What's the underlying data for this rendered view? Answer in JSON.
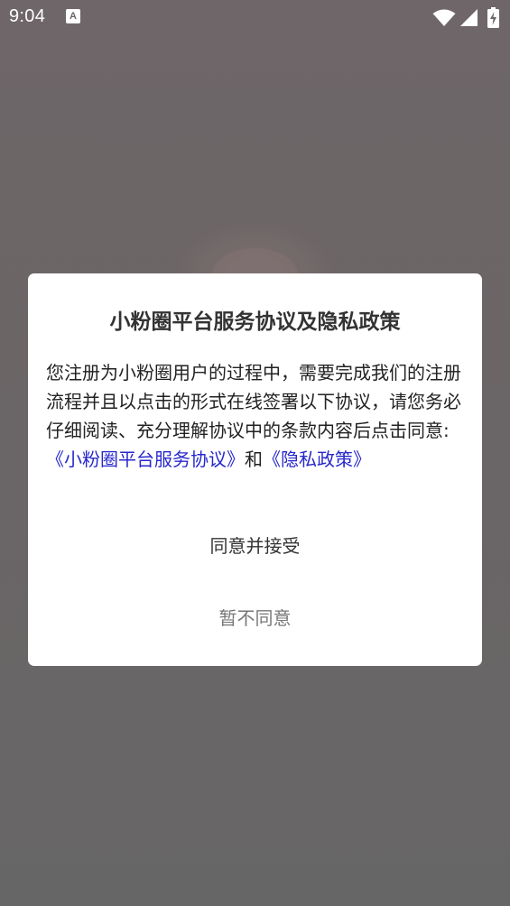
{
  "status_bar": {
    "time": "9:04",
    "notification_icon": "A",
    "icons": [
      "wifi-icon",
      "signal-icon",
      "battery-icon"
    ]
  },
  "dialog": {
    "title": "小粉圈平台服务协议及隐私政策",
    "body_text": "您注册为小粉圈用户的过程中，需要完成我们的注册流程并且以点击的形式在线签署以下协议，请您务必仔细阅读、充分理解协议中的条款内容后点击同意: ",
    "service_agreement_link": "《小粉圈平台服务协议》",
    "conjunction": "和",
    "privacy_policy_link": "《隐私政策》",
    "agree_button": "同意并接受",
    "disagree_button": "暂不同意"
  },
  "colors": {
    "overlay_background": "#6b6667",
    "dialog_background": "#ffffff",
    "link": "#2727cc",
    "title_text": "#333333",
    "secondary_button_text": "#777777"
  }
}
